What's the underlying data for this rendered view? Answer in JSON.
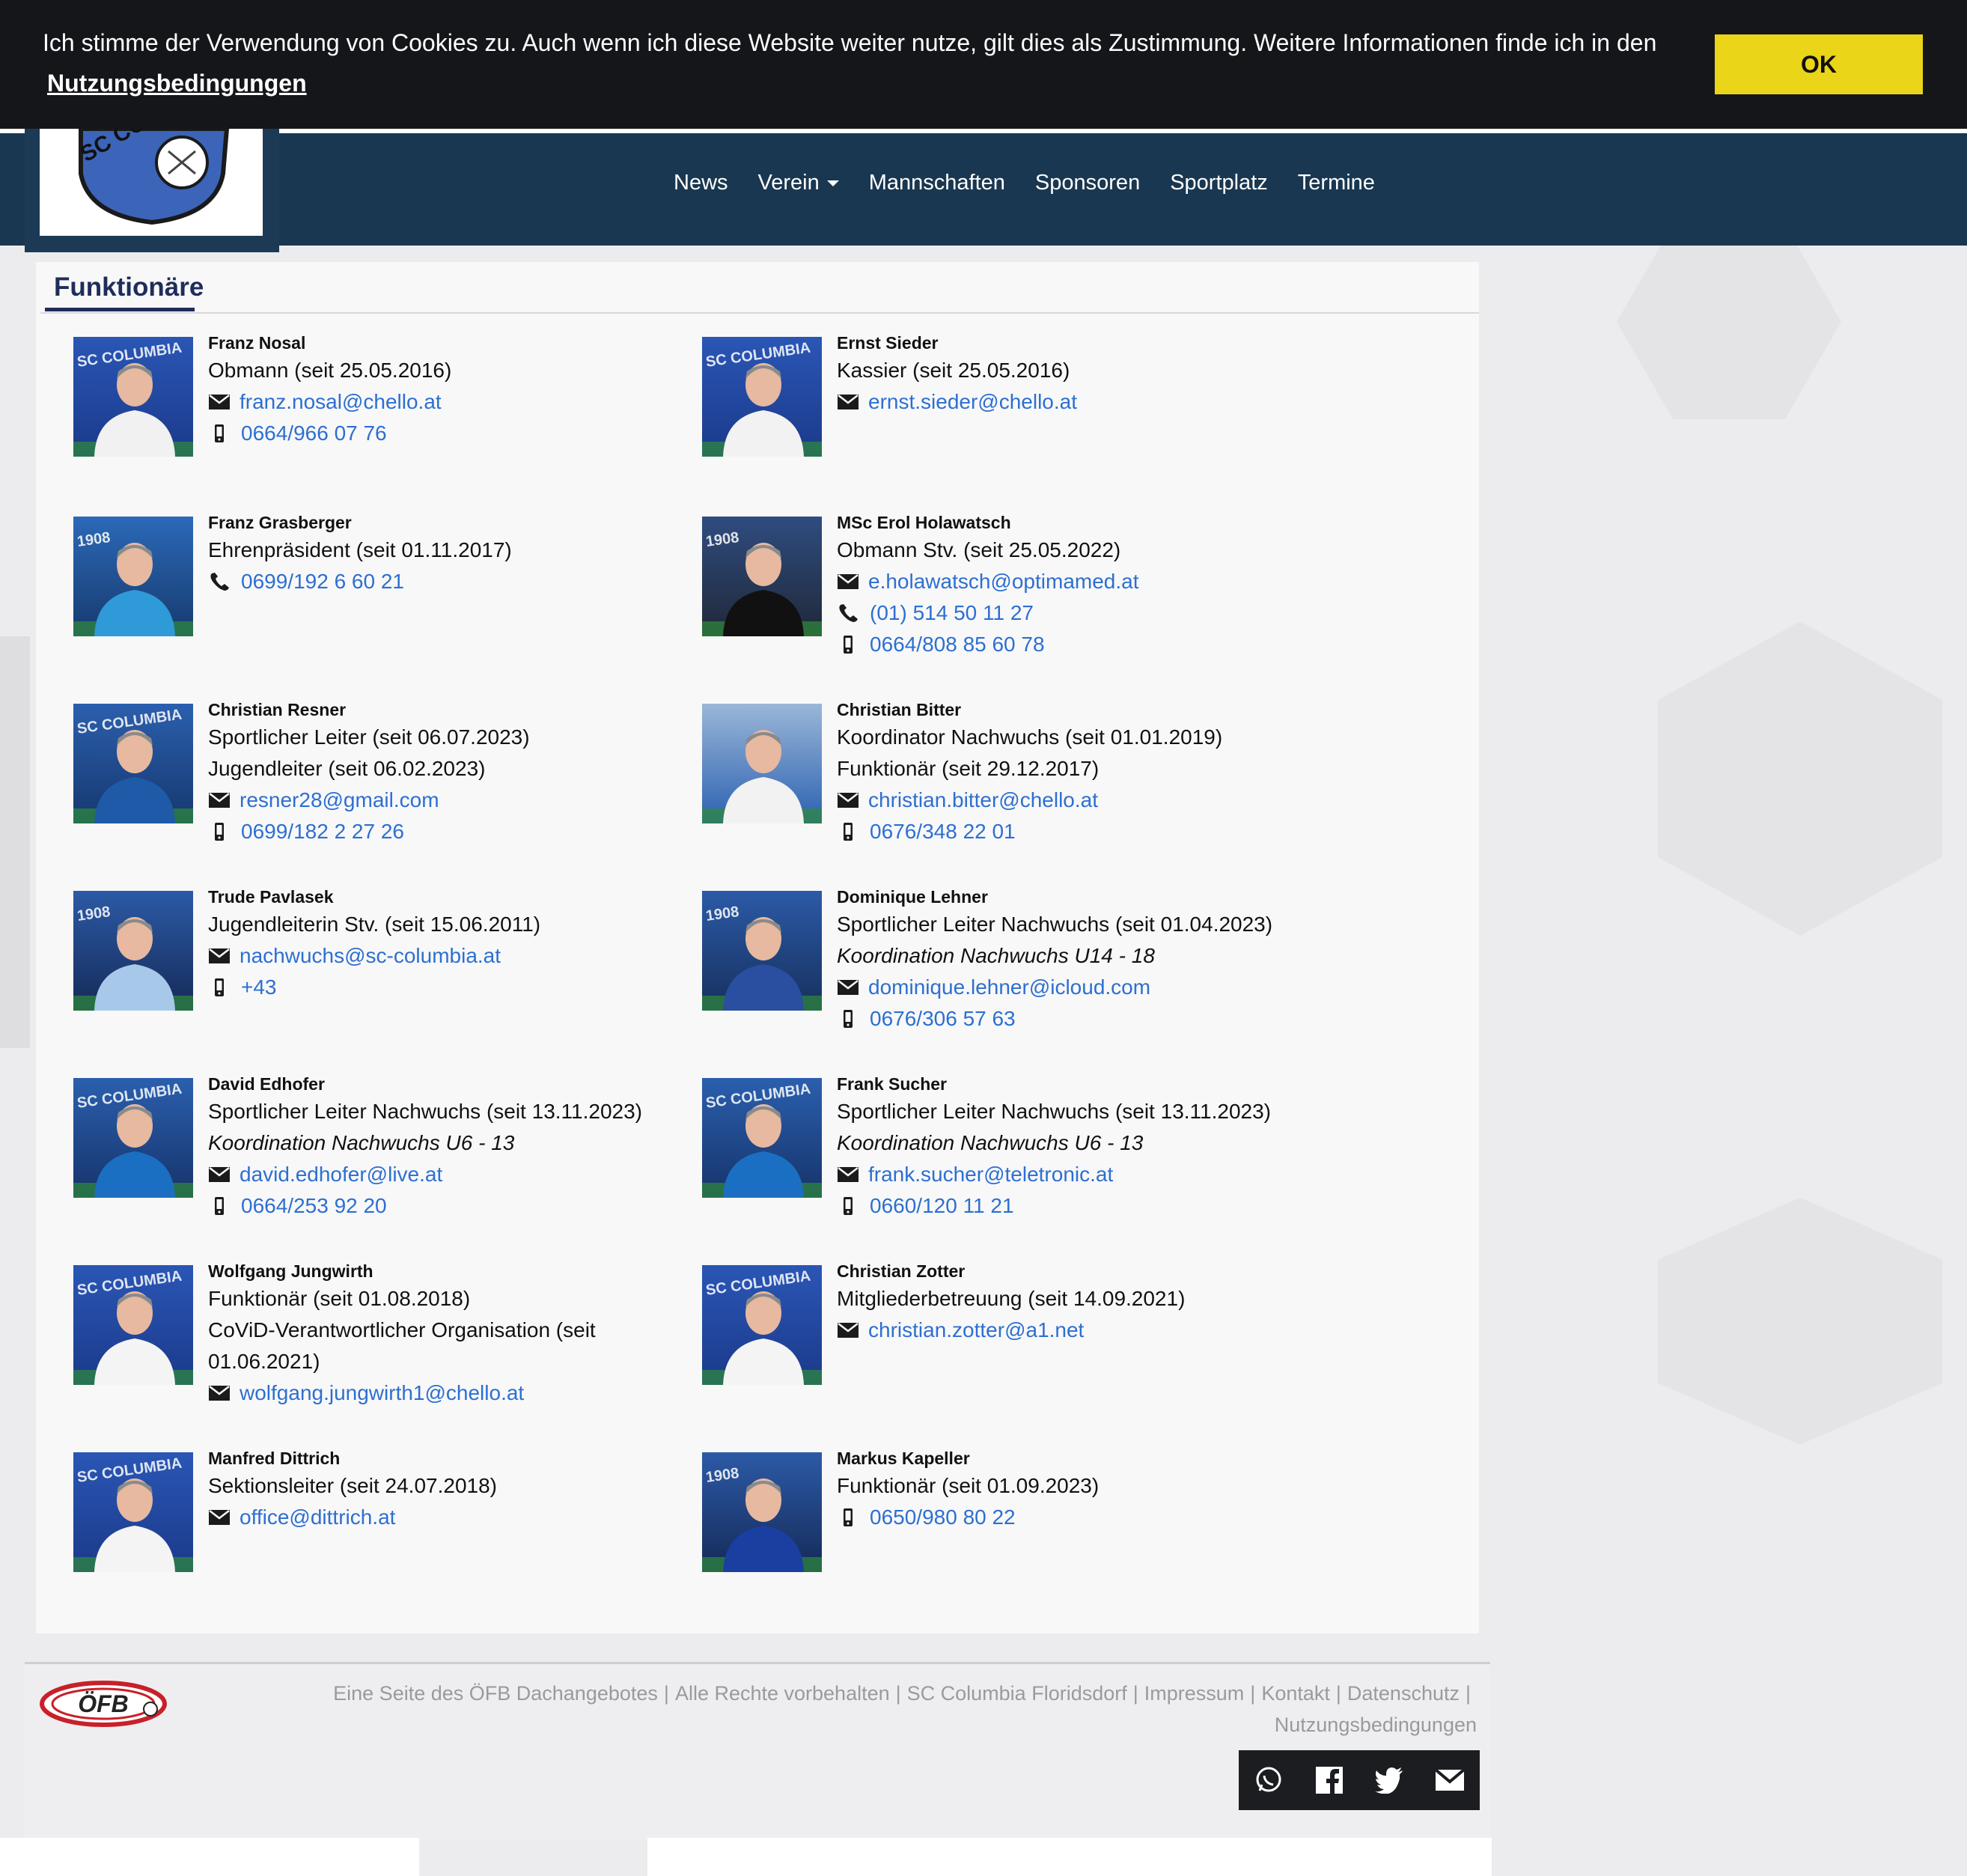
{
  "cookie": {
    "text": "Ich stimme der Verwendung von Cookies zu. Auch wenn ich diese Website weiter nutze, gilt dies als Zustimmung. Weitere Informationen finde ich in den",
    "link": "Nutzungsbedingungen",
    "ok": "OK"
  },
  "logo": {
    "text": "SC COL"
  },
  "nav": {
    "items": [
      "News",
      "Verein",
      "Mannschaften",
      "Sponsoren",
      "Sportplatz",
      "Termine"
    ]
  },
  "section": {
    "title": "Funktionäre"
  },
  "people": [
    {
      "name": "Franz Nosal",
      "roles": [
        "Obmann (seit 25.05.2016)"
      ],
      "email": "franz.nosal@chello.at",
      "mobile": "0664/966 07 76"
    },
    {
      "name": "Ernst Sieder",
      "roles": [
        "Kassier (seit 25.05.2016)"
      ],
      "email": "ernst.sieder@chello.at"
    },
    {
      "name": "Franz Grasberger",
      "roles": [
        "Ehrenpräsident (seit 01.11.2017)"
      ],
      "phone": "0699/192 6 60 21"
    },
    {
      "name": "MSc Erol Holawatsch",
      "roles": [
        "Obmann Stv. (seit 25.05.2022)"
      ],
      "email": "e.holawatsch@optimamed.at",
      "phone": "(01) 514 50 11 27",
      "mobile": "0664/808 85 60 78"
    },
    {
      "name": "Christian Resner",
      "roles": [
        "Sportlicher Leiter (seit 06.07.2023)",
        "Jugendleiter (seit 06.02.2023)"
      ],
      "email": "resner28@gmail.com",
      "mobile": "0699/182 2 27 26"
    },
    {
      "name": "Christian Bitter",
      "roles": [
        "Koordinator Nachwuchs (seit 01.01.2019)",
        "Funktionär (seit 29.12.2017)"
      ],
      "email": "christian.bitter@chello.at",
      "mobile": "0676/348 22 01"
    },
    {
      "name": "Trude Pavlasek",
      "roles": [
        "Jugendleiterin Stv. (seit 15.06.2011)"
      ],
      "email": "nachwuchs@sc-columbia.at",
      "mobile": "+43"
    },
    {
      "name": "Dominique Lehner",
      "roles": [
        "Sportlicher Leiter Nachwuchs (seit 01.04.2023)"
      ],
      "note": "Koordination Nachwuchs U14 - 18",
      "email": "dominique.lehner@icloud.com",
      "mobile": "0676/306 57 63"
    },
    {
      "name": "David Edhofer",
      "roles": [
        "Sportlicher Leiter Nachwuchs (seit 13.11.2023)"
      ],
      "note": "Koordination Nachwuchs U6 - 13",
      "email": "david.edhofer@live.at",
      "mobile": "0664/253 92 20"
    },
    {
      "name": "Frank Sucher",
      "roles": [
        "Sportlicher Leiter Nachwuchs (seit 13.11.2023)"
      ],
      "note": "Koordination Nachwuchs U6 - 13",
      "email": "frank.sucher@teletronic.at",
      "mobile": "0660/120 11 21"
    },
    {
      "name": "Wolfgang Jungwirth",
      "roles": [
        "Funktionär (seit 01.08.2018)",
        "CoViD-Verantwortlicher Organisation (seit",
        "01.06.2021)"
      ],
      "email": "wolfgang.jungwirth1@chello.at"
    },
    {
      "name": "Christian Zotter",
      "roles": [
        "Mitgliederbetreuung (seit 14.09.2021)"
      ],
      "email": "christian.zotter@a1.net"
    },
    {
      "name": "Manfred Dittrich",
      "roles": [
        "Sektionsleiter (seit 24.07.2018)"
      ],
      "email": "office@dittrich.at"
    },
    {
      "name": "Markus Kapeller",
      "roles": [
        "Funktionär (seit 01.09.2023)"
      ],
      "mobile": "0650/980 80 22"
    }
  ],
  "photo_banner": [
    "SC COLUMBIA",
    "SC COLUMBIA",
    "1908",
    "1908",
    "SC COLUMBIA",
    "",
    "1908",
    "1908",
    "SC COLUMBIA",
    "SC COLUMBIA",
    "SC COLUMBIA",
    "SC COLUMBIA",
    "SC COLUMBIA",
    "1908"
  ],
  "footer": {
    "logo": "ÖFB",
    "links": [
      "Eine Seite des ÖFB Dachangebotes",
      "Alle Rechte vorbehalten",
      "SC Columbia Floridsdorf",
      "Impressum",
      "Kontakt",
      "Datenschutz",
      "Nutzungsbedingungen"
    ],
    "separator": "|",
    "social": [
      "whatsapp-icon",
      "facebook-icon",
      "twitter-icon",
      "mail-icon"
    ]
  },
  "colors": {
    "navy": "#193750",
    "link": "#2d6fd0",
    "cookie_button": "#ead519",
    "heading": "#1f2d5a"
  }
}
